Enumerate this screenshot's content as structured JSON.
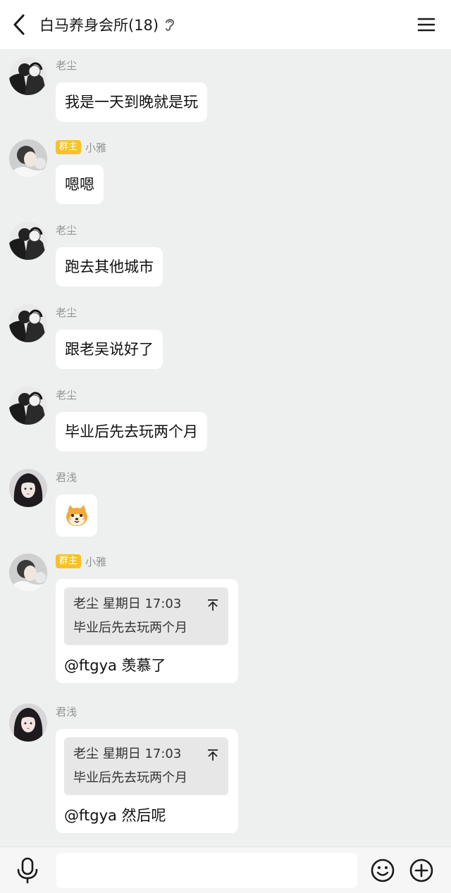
{
  "header": {
    "title": "白马养身会所(18)"
  },
  "messages": [
    {
      "sender": "老尘",
      "text": "我是一天到晚就是玩"
    },
    {
      "sender": "小雅",
      "badge": "群主",
      "text": "嗯嗯"
    },
    {
      "sender": "老尘",
      "text": "跑去其他城市"
    },
    {
      "sender": "老尘",
      "text": "跟老吴说好了"
    },
    {
      "sender": "老尘",
      "text": "毕业后先去玩两个月"
    },
    {
      "sender": "君浅",
      "sticker": "shiba-dog-sticker"
    },
    {
      "sender": "小雅",
      "badge": "群主",
      "quote": {
        "author": "老尘",
        "time": "星期日 17:03",
        "text": "毕业后先去玩两个月"
      },
      "text": "@ftgya 羡慕了"
    },
    {
      "sender": "君浅",
      "quote": {
        "author": "老尘",
        "time": "星期日 17:03",
        "text": "毕业后先去玩两个月"
      },
      "text": "@ftgya 然后呢"
    }
  ],
  "footer": {
    "input_placeholder": ""
  },
  "colors": {
    "background": "#edf0ee",
    "bubble": "#ffffff",
    "badge": "#f6c12b",
    "quote": "#e6e7e6"
  },
  "icons": [
    "back-arrow-icon",
    "ear-icon",
    "menu-icon",
    "microphone-icon",
    "emoji-icon",
    "plus-icon"
  ]
}
